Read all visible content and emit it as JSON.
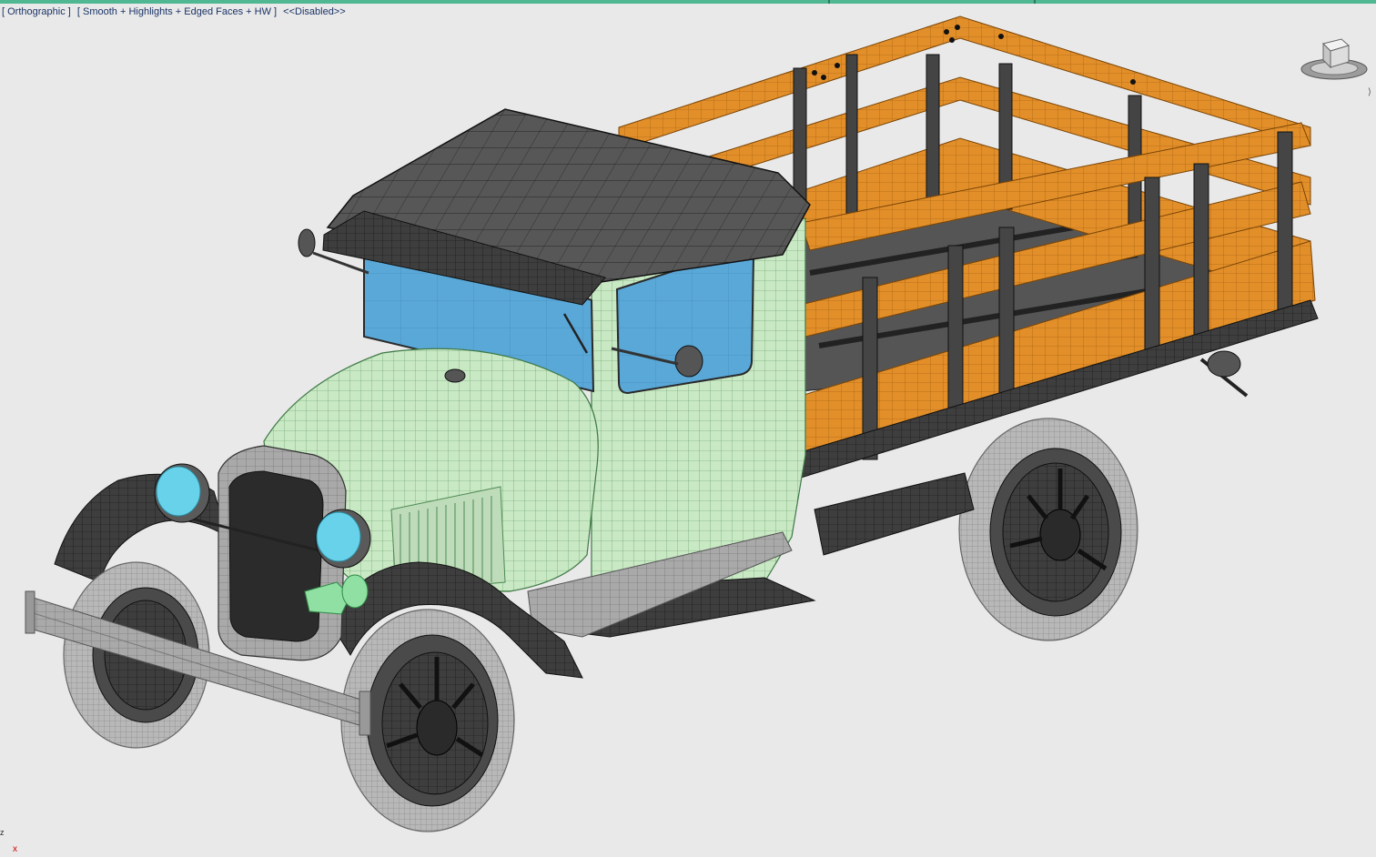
{
  "viewport": {
    "label_parts": [
      "[ Orthographic ]",
      "[ Smooth + Highlights + Edged Faces + HW ]",
      "<<Disabled>>"
    ],
    "axis_x_label": "x",
    "axis_z_label": "z"
  },
  "colors": {
    "background": "#e9e9e9",
    "top_strip": "#4fb893",
    "label_text": "#1a3366",
    "cab_body": "#c9e8c4",
    "cab_wire": "#4f8a55",
    "roof": "#555555",
    "bed_wood": "#e28f2a",
    "bed_wire": "#9a5608",
    "glass": "#5aa8d8",
    "headlamp": "#68d2ea",
    "tire": "#b5b5b5",
    "hub": "#3a3a3a",
    "fender": "#3a3a3a"
  },
  "icons": {
    "viewcube": "viewcube-icon",
    "axis": "axis-tripod-icon"
  }
}
